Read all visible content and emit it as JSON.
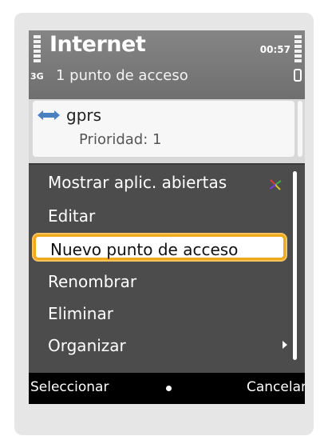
{
  "header": {
    "title": "Internet",
    "time": "00:57",
    "network_type": "3G",
    "subtitle": "1 punto de acceso"
  },
  "access_point": {
    "icon": "bidirectional-arrow-icon",
    "name": "gprs",
    "priority": "Prioridad: 1"
  },
  "menu": {
    "items": [
      {
        "label": "Mostrar aplic. abiertas",
        "icon": "multitask-star-icon"
      },
      {
        "label": "Editar"
      },
      {
        "label": "Nuevo punto de acceso",
        "selected": true
      },
      {
        "label": "Renombrar"
      },
      {
        "label": "Eliminar"
      },
      {
        "label": "Organizar",
        "has_submenu": true
      }
    ]
  },
  "softkeys": {
    "left": "Seleccionar",
    "right": "Cancelar"
  },
  "colors": {
    "highlight_border": "#f0a81c",
    "menu_background": "#4c4c4c",
    "header_background": "#7a7a7a"
  }
}
